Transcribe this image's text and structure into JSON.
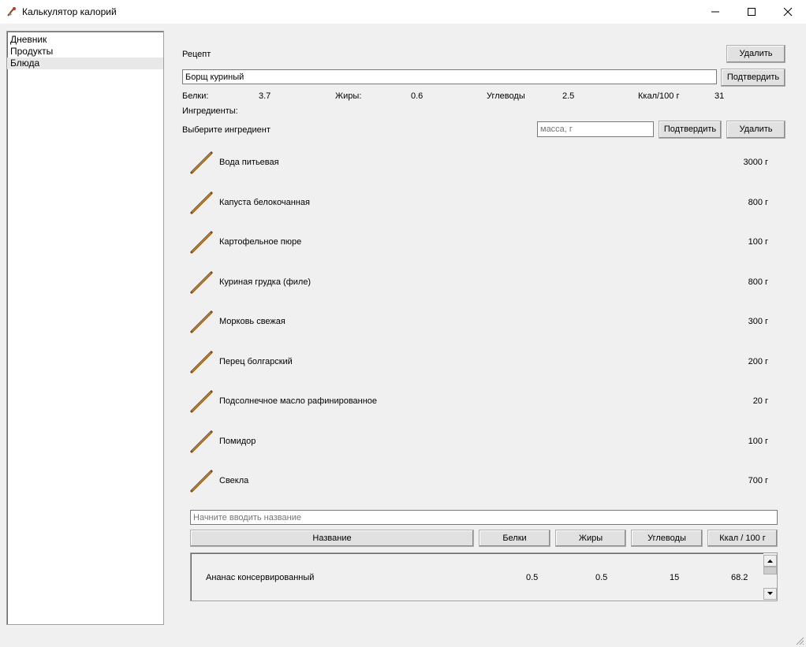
{
  "window": {
    "title": "Калькулятор калорий"
  },
  "nav": {
    "items": [
      "Дневник",
      "Продукты",
      "Блюда"
    ],
    "selected_index": 2
  },
  "recipe": {
    "label": "Рецепт",
    "delete_label": "Удалить",
    "name_value": "Борщ куриный",
    "confirm_label": "Подтвердить",
    "protein_label": "Белки:",
    "protein_value": "3.7",
    "fat_label": "Жиры:",
    "fat_value": "0.6",
    "carbs_label": "Углеводы",
    "carbs_value": "2.5",
    "kcal_label": "Ккал/100 г",
    "kcal_value": "31",
    "ingredients_label": "Ингредиенты:",
    "choose_label": "Выберите ингредиент",
    "mass_placeholder": "масса, г",
    "ing_confirm_label": "Подтвердить",
    "ing_delete_label": "Удалить"
  },
  "ingredients": [
    {
      "name": "Вода питьевая",
      "mass": "3000  г"
    },
    {
      "name": "Капуста белокочанная",
      "mass": "800  г"
    },
    {
      "name": "Картофельное пюре",
      "mass": "100  г"
    },
    {
      "name": "Куриная грудка (филе)",
      "mass": "800  г"
    },
    {
      "name": "Морковь свежая",
      "mass": "300  г"
    },
    {
      "name": "Перец болгарский",
      "mass": "200  г"
    },
    {
      "name": "Подсолнечное масло рафинированное",
      "mass": "20  г"
    },
    {
      "name": "Помидор",
      "mass": "100  г"
    },
    {
      "name": "Свекла",
      "mass": "700  г"
    }
  ],
  "search": {
    "placeholder": "Начните вводить название"
  },
  "table": {
    "headers": [
      "Название",
      "Белки",
      "Жиры",
      "Углеводы",
      "Ккал / 100 г"
    ],
    "rows": [
      {
        "name": "Ананас консервированный",
        "protein": "0.5",
        "fat": "0.5",
        "carbs": "15",
        "kcal": "68.2"
      }
    ]
  }
}
